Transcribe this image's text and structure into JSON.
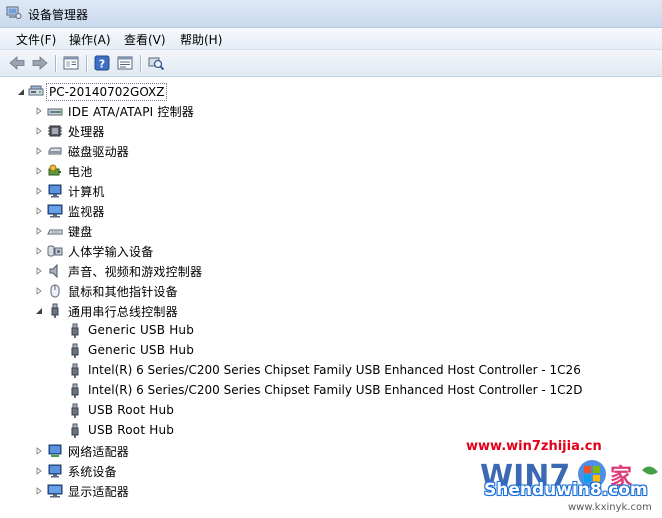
{
  "window": {
    "title": "设备管理器"
  },
  "menu": {
    "items": [
      {
        "label": "文件(F)"
      },
      {
        "label": "操作(A)"
      },
      {
        "label": "查看(V)"
      },
      {
        "label": "帮助(H)"
      }
    ]
  },
  "toolbar": {
    "buttons": [
      {
        "icon": "back-arrow-icon"
      },
      {
        "icon": "forward-arrow-icon"
      },
      {
        "icon": "console-tree-icon"
      },
      {
        "icon": "help-icon"
      },
      {
        "icon": "properties-icon"
      },
      {
        "icon": "scan-hardware-icon"
      }
    ]
  },
  "tree": {
    "root": {
      "label": "PC-20140702GOXZ",
      "expanded": true
    },
    "categories": [
      {
        "label": "IDE ATA/ATAPI 控制器",
        "icon": "ide-controller-icon",
        "expanded": false
      },
      {
        "label": "处理器",
        "icon": "processor-icon",
        "expanded": false
      },
      {
        "label": "磁盘驱动器",
        "icon": "disk-drive-icon",
        "expanded": false
      },
      {
        "label": "电池",
        "icon": "battery-icon",
        "expanded": false
      },
      {
        "label": "计算机",
        "icon": "computer-icon",
        "expanded": false
      },
      {
        "label": "监视器",
        "icon": "monitor-icon",
        "expanded": false
      },
      {
        "label": "键盘",
        "icon": "keyboard-icon",
        "expanded": false
      },
      {
        "label": "人体学输入设备",
        "icon": "hid-icon",
        "expanded": false
      },
      {
        "label": "声音、视频和游戏控制器",
        "icon": "sound-icon",
        "expanded": false
      },
      {
        "label": "鼠标和其他指针设备",
        "icon": "mouse-icon",
        "expanded": false
      },
      {
        "label": "通用串行总线控制器",
        "icon": "usb-icon",
        "expanded": true,
        "children": [
          {
            "label": "Generic USB Hub"
          },
          {
            "label": "Generic USB Hub"
          },
          {
            "label": "Intel(R) 6 Series/C200 Series Chipset Family USB Enhanced Host Controller - 1C26"
          },
          {
            "label": "Intel(R) 6 Series/C200 Series Chipset Family USB Enhanced Host Controller - 1C2D"
          },
          {
            "label": "USB Root Hub"
          },
          {
            "label": "USB Root Hub"
          }
        ]
      },
      {
        "label": "网络适配器",
        "icon": "network-adapter-icon",
        "expanded": false
      },
      {
        "label": "系统设备",
        "icon": "system-device-icon",
        "expanded": false
      },
      {
        "label": "显示适配器",
        "icon": "display-adapter-icon",
        "expanded": false
      }
    ]
  },
  "watermark": {
    "url": "www.win7zhijia.cn",
    "brand": "Shenduwin8.com",
    "sub": "www.kxinyk.com"
  }
}
